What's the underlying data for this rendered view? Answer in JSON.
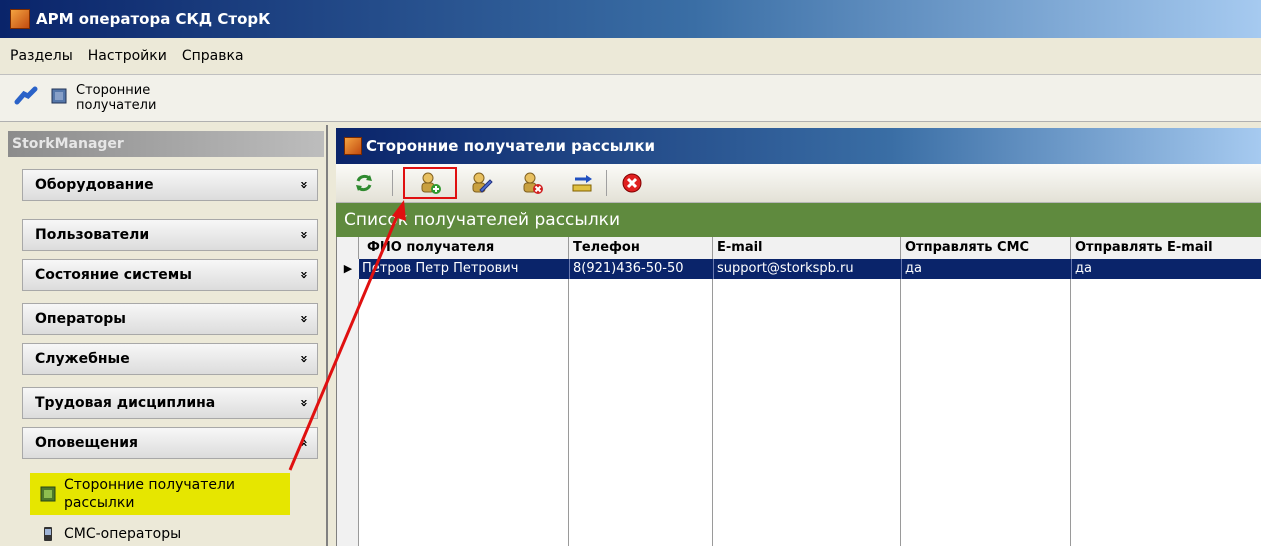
{
  "window": {
    "title": "АРМ оператора СКД СторК"
  },
  "menu": [
    "Разделы",
    "Настройки",
    "Справка"
  ],
  "nav_toolbar": {
    "label_line1": "Сторонние",
    "label_line2": "получатели"
  },
  "left": {
    "header": "StorkManager",
    "groups": [
      {
        "label": "Оборудование",
        "chev": "»"
      },
      {
        "label": "Пользователи",
        "chev": "»"
      },
      {
        "label": "Состояние системы",
        "chev": "»"
      },
      {
        "label": "Операторы",
        "chev": "»"
      },
      {
        "label": "Служебные",
        "chev": "»"
      },
      {
        "label": "Трудовая дисциплина",
        "chev": "»"
      },
      {
        "label": "Оповещения",
        "chev": "«"
      }
    ],
    "sub_items": [
      {
        "label_line1": "Сторонние получатели",
        "label_line2": "рассылки"
      },
      {
        "label_line1": "СМС-операторы"
      }
    ]
  },
  "panel": {
    "title": "Сторонние получатели рассылки",
    "caption": "Список получателей рассылки",
    "columns": [
      "ФИО получателя",
      "Телефон",
      "E-mail",
      "Отправлять СМС",
      "Отправлять E-mail"
    ],
    "rows": [
      [
        "Петров Петр Петрович",
        "8(921)436-50-50",
        "support@storkspb.ru",
        "да",
        "да"
      ]
    ]
  },
  "colors": {
    "title_blue": "#0a246a",
    "caption_green": "#5f8a3e",
    "highlight": "#e6e600",
    "annotation_red": "#e01010"
  }
}
